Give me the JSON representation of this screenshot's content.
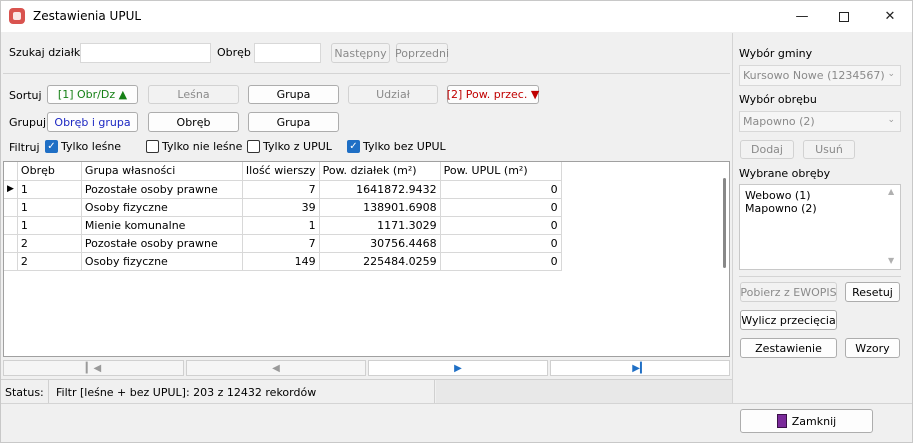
{
  "window": {
    "title": "Zestawienia UPUL"
  },
  "search": {
    "parcel_label": "Szukaj działki",
    "parcel_value": "",
    "precinct_label": "Obręb",
    "precinct_value": "",
    "next_label": "Następny",
    "prev_label": "Poprzedni"
  },
  "sort": {
    "label": "Sortuj",
    "buttons": [
      "[1] Obr/Dz",
      "Leśna",
      "Grupa",
      "Udział",
      "[2] Pow. przec."
    ]
  },
  "group": {
    "label": "Grupuj",
    "buttons": [
      "Obręb i grupa",
      "Obręb",
      "Grupa"
    ]
  },
  "filter": {
    "label": "Filtruj",
    "options": [
      {
        "label": "Tylko leśne",
        "checked": true
      },
      {
        "label": "Tylko nie leśne",
        "checked": false
      },
      {
        "label": "Tylko z UPUL",
        "checked": false
      },
      {
        "label": "Tylko bez UPUL",
        "checked": true
      }
    ]
  },
  "table": {
    "columns": [
      "Obręb",
      "Grupa własności",
      "Ilość wierszy",
      "Pow. działek (m²)",
      "Pow. UPUL (m²)"
    ],
    "rows": [
      [
        "1",
        "Pozostałe osoby prawne",
        "7",
        "1641872.9432",
        "0"
      ],
      [
        "1",
        "Osoby fizyczne",
        "39",
        "138901.6908",
        "0"
      ],
      [
        "1",
        "Mienie komunalne",
        "1",
        "1171.3029",
        "0"
      ],
      [
        "2",
        "Pozostałe osoby prawne",
        "7",
        "30756.4468",
        "0"
      ],
      [
        "2",
        "Osoby fizyczne",
        "149",
        "225484.0259",
        "0"
      ]
    ]
  },
  "status": {
    "label": "Status:",
    "text": "Filtr [leśne + bez UPUL]: 203 z 12432 rekordów"
  },
  "right": {
    "gmina_label": "Wybór gminy",
    "gmina_value": "Kursowo Nowe (1234567)",
    "obreb_label": "Wybór obrębu",
    "obreb_value": "Mapowno (2)",
    "add_label": "Dodaj",
    "remove_label": "Usuń",
    "selected_label": "Wybrane obręby",
    "selected": [
      "Webowo (1)",
      "Mapowno (2)"
    ],
    "fetch_label": "Pobierz z EWOPIS",
    "reset_label": "Resetuj",
    "compute_label": "Wylicz przecięcia",
    "report_label": "Zestawienie",
    "templates_label": "Wzory",
    "close_label": "Zamknij"
  },
  "icons": {
    "app": "app-icon",
    "minimize": "minimize-icon",
    "maximize": "maximize-icon",
    "close": "close-icon",
    "sort_up": "arrow-up-icon",
    "sort_down": "arrow-down-icon",
    "check": "check-icon",
    "row_pointer": "row-pointer-icon",
    "exit": "door-exit-icon"
  },
  "colors": {
    "sort_active_asc": "#168016",
    "sort_active_desc": "#c00000",
    "group_active": "#1c27c2",
    "checkbox_on": "#1f6fc5"
  }
}
